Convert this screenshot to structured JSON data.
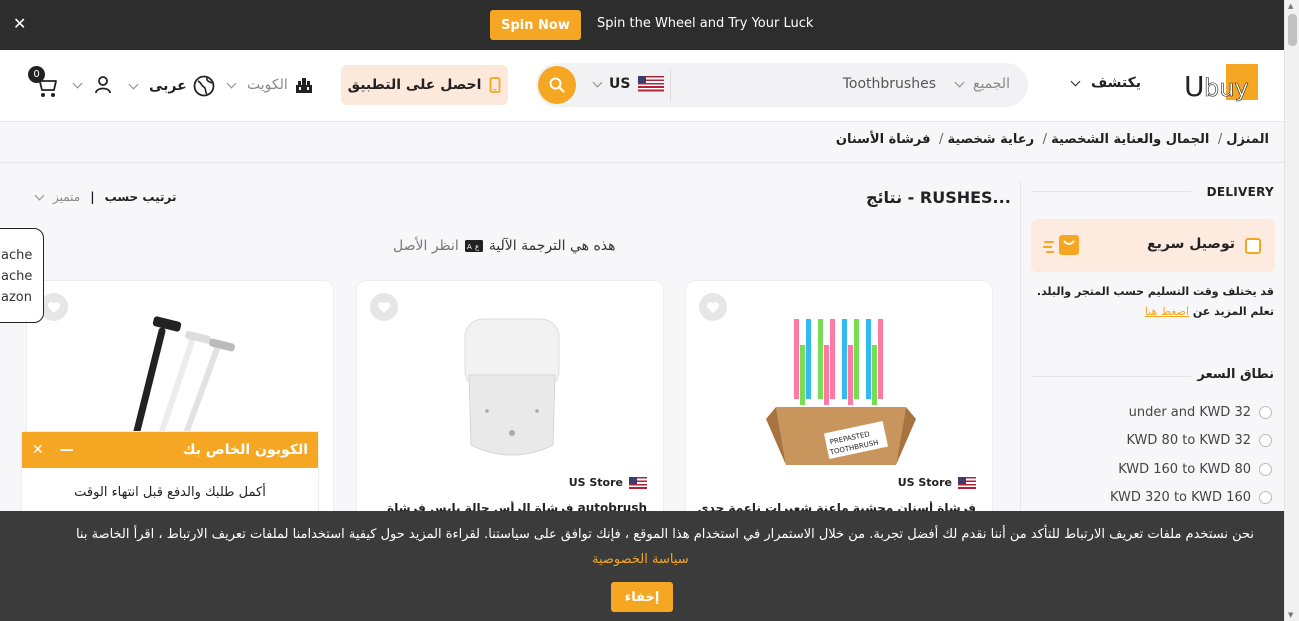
{
  "topbar": {
    "spin_label": "Spin Now",
    "spin_text": "Spin the Wheel and Try Your Luck",
    "accent": "#f5a623"
  },
  "header": {
    "cart_count": "0",
    "language": "عربى",
    "country": "الكويت",
    "app_button": "احصل على التطبيق",
    "search": {
      "store_country": "US",
      "query": "Toothbrushes",
      "category": "الجميع"
    },
    "explore": "يكتشف",
    "logo_text": "Ubuy"
  },
  "breadcrumb": [
    "المنزل",
    "الجمال والعناية الشخصية",
    "رعاية شخصية",
    "فرشاة الأسنان"
  ],
  "sidebar": {
    "delivery_title": "DELIVERY",
    "fast_delivery": "توصيل سريع",
    "note": "قد يختلف وقت التسليم حسب المتجر والبلد. تعلم المزيد عن",
    "note_link": "اضغط هنا",
    "price_title": "نطاق السعر",
    "price_ranges": [
      "under  and KWD 32",
      "KWD 80 to KWD 32",
      "KWD 160 to KWD 80",
      "KWD 320 to KWD 160"
    ]
  },
  "results": {
    "title": "نتائج - RUSHES...",
    "sort_label": "ترتيب حسب",
    "sort_value": "متميز",
    "translation_note": "هذه هي الترجمة الآلية",
    "see_original": "انظر الأصل"
  },
  "products": [
    {
      "store": "US Store",
      "title": "فرشاة أسنان محشية ماعنة شعيرات ناعمة جدي"
    },
    {
      "store": "US Store",
      "title": "autobrush فرشاة الرأس حالة يابس فرشاة"
    },
    {
      "store": "",
      "title": ""
    }
  ],
  "side_popup": [
    "ache",
    "ache",
    "azon"
  ],
  "coupon": {
    "title": "الكوبون الخاص بك",
    "body": "أكمل طلبك والدفع قبل انتهاء الوقت"
  },
  "cookie": {
    "text": "نحن نستخدم ملفات تعريف الارتباط للتأكد من أننا نقدم لك أفضل تجربة. من خلال الاستمرار في استخدام هذا الموقع ، فإنك توافق على سياستنا. لقراءة المزيد حول كيفية استخدامنا لملفات تعريف الارتباط ، اقرأ الخاصة بنا",
    "policy_link": "سياسة الخصوصية",
    "hide_button": "إخفاء"
  }
}
